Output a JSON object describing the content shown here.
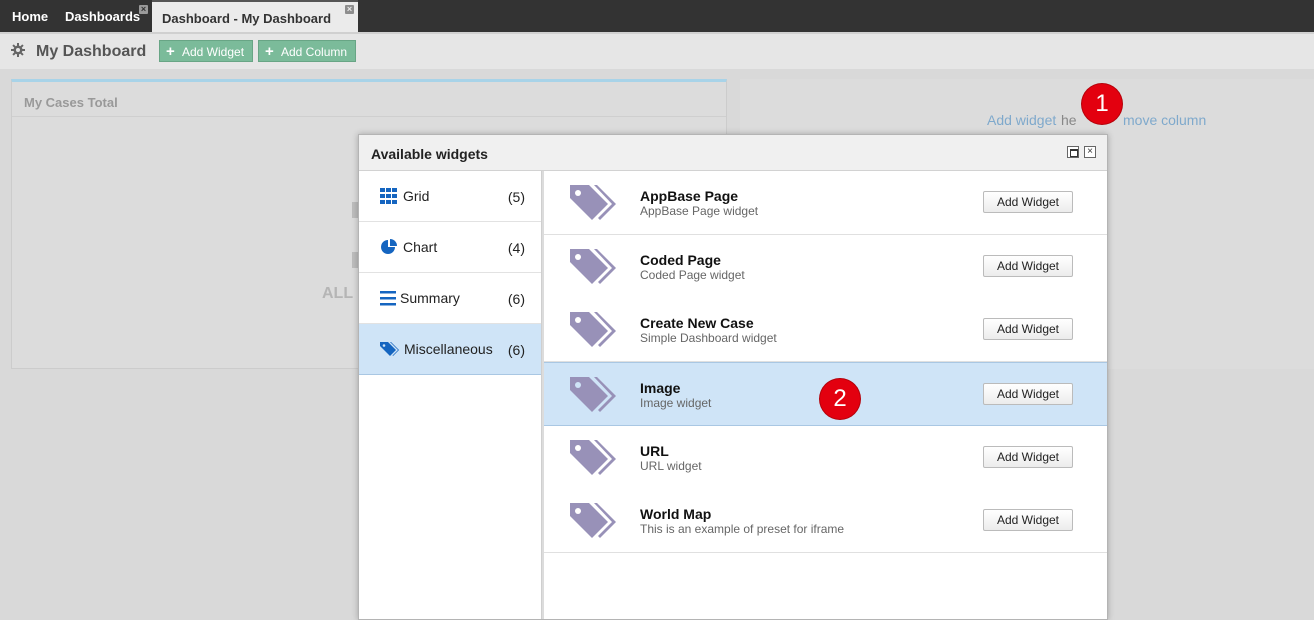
{
  "tabs": [
    {
      "label": "Home"
    },
    {
      "label": "Dashboards",
      "close": "×"
    },
    {
      "label": "Dashboard - My Dashboard",
      "close": "×"
    }
  ],
  "toolbar": {
    "title": "My Dashboard",
    "add_widget": "Add Widget",
    "add_column": "Add Column",
    "settings_icon": "gear-icon",
    "plus_icon": "plus-icon"
  },
  "column1": {
    "panel_title": "My Cases Total",
    "partial_text": "ALL"
  },
  "column2": {
    "add_widget_link": "Add widget",
    "partial_text": "he",
    "remove_column_link": "move column"
  },
  "markers": {
    "one": "1",
    "two": "2"
  },
  "dialog": {
    "title": "Available widgets",
    "maximize_icon": "maximize-icon",
    "close_icon": "close-icon",
    "categories": [
      {
        "label": "Grid",
        "count": "(5)",
        "icon": "grid-icon"
      },
      {
        "label": "Chart",
        "count": "(4)",
        "icon": "pie-chart-icon"
      },
      {
        "label": "Summary",
        "count": "(6)",
        "icon": "list-icon"
      },
      {
        "label": "Miscellaneous",
        "count": "(6)",
        "icon": "tag-icon"
      }
    ],
    "selected_category": "Miscellaneous",
    "widgets": [
      {
        "name": "AppBase Page",
        "desc": "AppBase Page widget",
        "button": "Add Widget"
      },
      {
        "name": "Coded Page",
        "desc": "Coded Page widget",
        "button": "Add Widget"
      },
      {
        "name": "Create New Case",
        "desc": "Simple Dashboard widget",
        "button": "Add Widget"
      },
      {
        "name": "Image",
        "desc": "Image widget",
        "button": "Add Widget"
      },
      {
        "name": "URL",
        "desc": "URL widget",
        "button": "Add Widget"
      },
      {
        "name": "World Map",
        "desc": "This is an example of preset for iframe",
        "button": "Add Widget"
      }
    ],
    "selected_widget": "Image"
  },
  "colors": {
    "accent_green": "#7bbb9a",
    "selected_row": "#cfe4f7",
    "marker_red": "#e3000f",
    "tag_icon": "#9891b8",
    "category_icon": "#1565c0"
  }
}
